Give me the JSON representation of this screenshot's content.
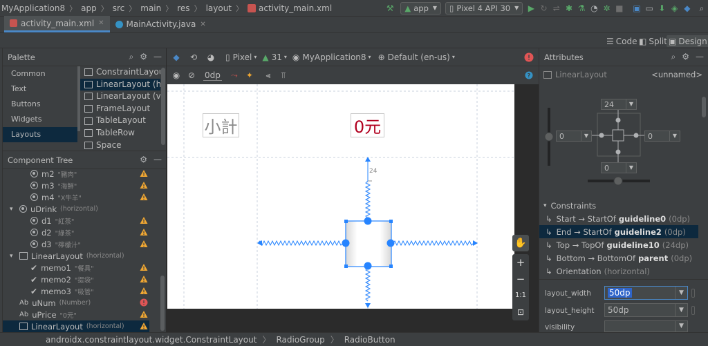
{
  "topbar": {
    "breadcrumb": [
      "MyApplication8",
      "app",
      "src",
      "main",
      "res",
      "layout",
      "activity_main.xml"
    ],
    "run_config": "app",
    "device": "Pixel 4 API 30"
  },
  "tabs": [
    {
      "label": "activity_main.xml",
      "active": true
    },
    {
      "label": "MainActivity.java",
      "active": false
    }
  ],
  "modes": {
    "code": "Code",
    "split": "Split",
    "design": "Design"
  },
  "palette": {
    "title": "Palette",
    "categories": [
      "Common",
      "Text",
      "Buttons",
      "Widgets",
      "Layouts"
    ],
    "selected_category": "Layouts",
    "items": [
      "ConstraintLayout",
      "LinearLayout (h...",
      "LinearLayout (v...",
      "FrameLayout",
      "TableLayout",
      "TableRow",
      "Space"
    ]
  },
  "tree": {
    "title": "Component Tree",
    "rows": [
      {
        "name": "m2",
        "hint": "\"豬肉\"",
        "icon": "radio"
      },
      {
        "name": "m3",
        "hint": "\"海鮮\"",
        "icon": "radio"
      },
      {
        "name": "m4",
        "hint": "\"X牛羊\"",
        "icon": "radio"
      },
      {
        "name": "uDrink",
        "hint": "(horizontal)",
        "icon": "radio"
      },
      {
        "name": "d1",
        "hint": "\"紅茶\"",
        "icon": "radio"
      },
      {
        "name": "d2",
        "hint": "\"綠茶\"",
        "icon": "radio"
      },
      {
        "name": "d3",
        "hint": "\"檸檬汁\"",
        "icon": "radio"
      },
      {
        "name": "LinearLayout",
        "hint": "(horizontal)",
        "icon": "linear"
      },
      {
        "name": "memo1",
        "hint": "\"餐具\"",
        "icon": "check"
      },
      {
        "name": "memo2",
        "hint": "\"提袋\"",
        "icon": "check"
      },
      {
        "name": "memo3",
        "hint": "\"吸管\"",
        "icon": "check"
      },
      {
        "name": "uNum",
        "hint": "(Number)",
        "icon": "ab"
      },
      {
        "name": "uPrice",
        "hint": "\"0元\"",
        "icon": "ab"
      },
      {
        "name": "LinearLayout",
        "hint": "(horizontal)",
        "icon": "linear"
      }
    ]
  },
  "design_toolbar": {
    "device": "Pixel",
    "api": "31",
    "theme": "MyApplication8",
    "locale": "Default (en-us)",
    "margin": "0dp"
  },
  "canvas": {
    "label_subtotal": "小計",
    "label_price": "0元",
    "margin_value": "24"
  },
  "zoom": {
    "one_to_one": "1:1"
  },
  "attributes": {
    "title": "Attributes",
    "component": "LinearLayout",
    "id": "<unnamed>",
    "margins": {
      "top": "24",
      "left": "0",
      "right": "0",
      "bottom": "0"
    },
    "constraints_title": "Constraints",
    "constraints": [
      {
        "prefix": "Start → StartOf",
        "target": "guideline0",
        "value": "(0dp)"
      },
      {
        "prefix": "End → StartOf",
        "target": "guideline2",
        "value": "(0dp)"
      },
      {
        "prefix": "Top → TopOf",
        "target": "guideline10",
        "value": "(24dp)"
      },
      {
        "prefix": "Bottom → BottomOf",
        "target": "parent",
        "value": "(0dp)"
      },
      {
        "prefix": "Orientation",
        "target": "",
        "value": "(horizontal)"
      }
    ],
    "layout_width_label": "layout_width",
    "layout_width": "50dp",
    "layout_height_label": "layout_height",
    "layout_height": "50dp",
    "visibility_label": "visibility",
    "visibility": ""
  },
  "statusbar": [
    "androidx.constraintlayout.widget.ConstraintLayout",
    "RadioGroup",
    "RadioButton"
  ],
  "colors": {
    "accent": "#4a88c7",
    "selection": "#0d293e",
    "warning": "#f0a732",
    "error": "#e05555",
    "price_red": "#b1001f",
    "blueprint": "#2684ff"
  }
}
